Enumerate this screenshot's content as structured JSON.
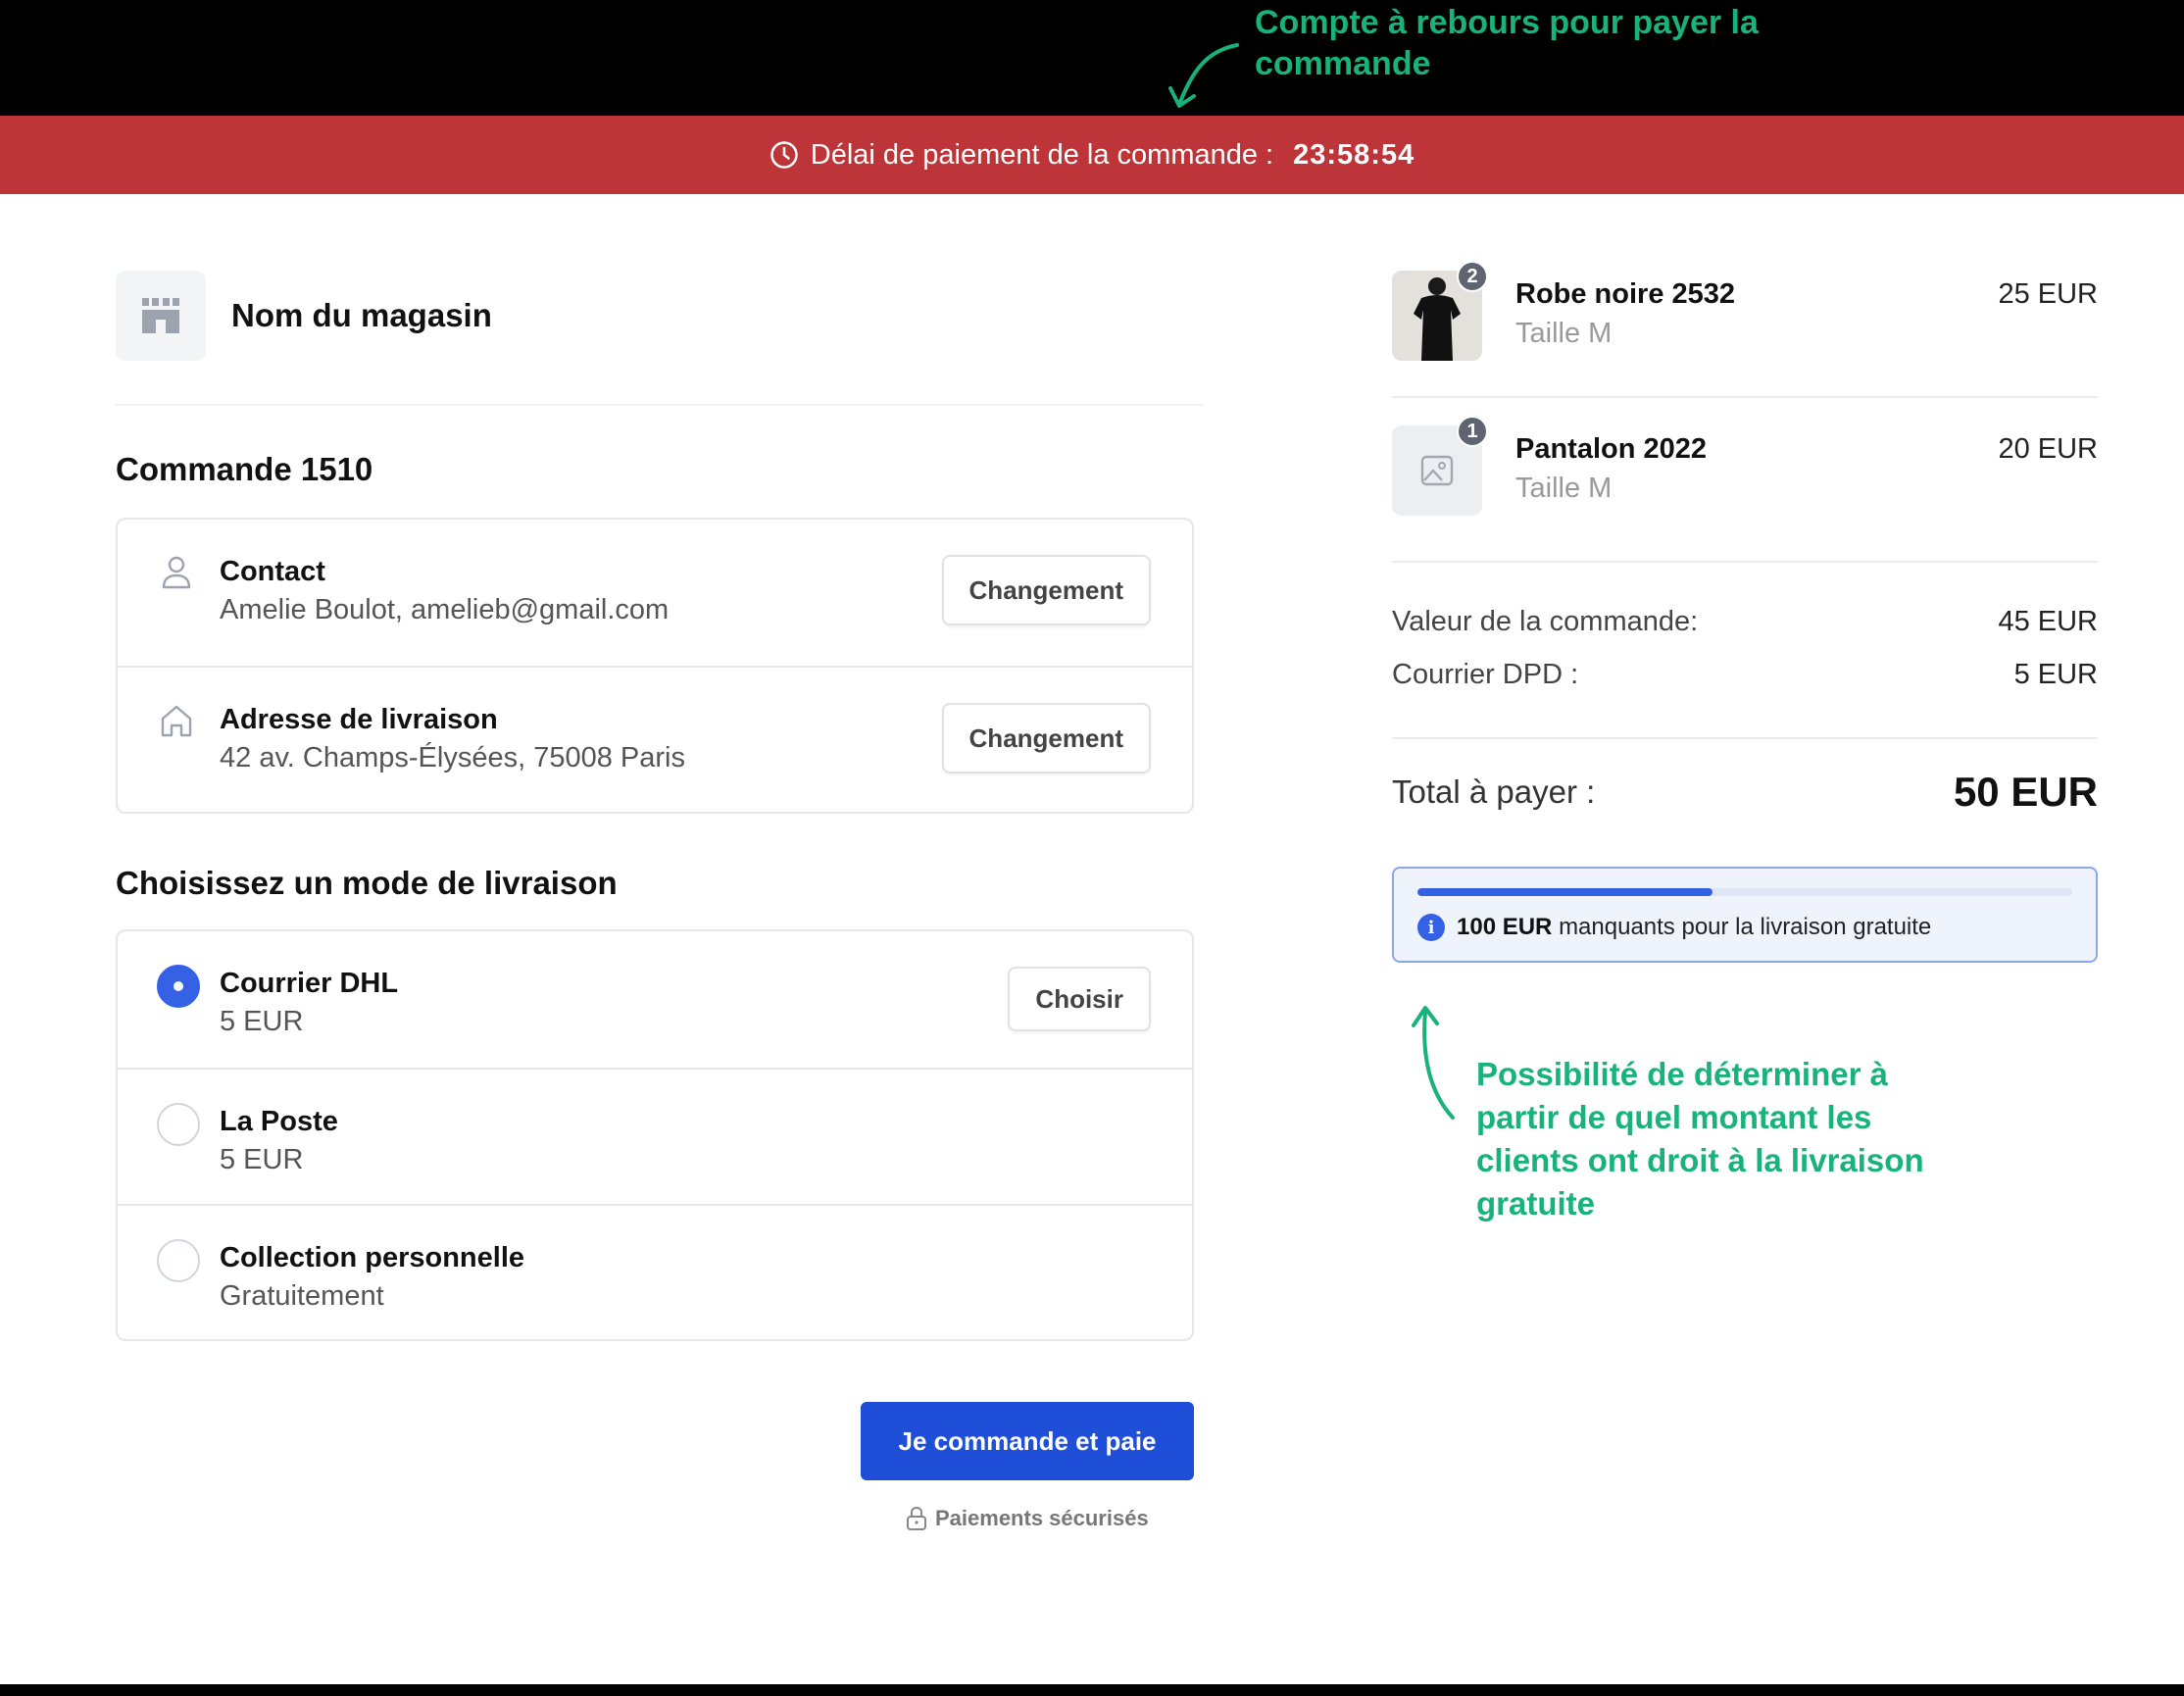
{
  "annotations": {
    "countdown": "Compte à rebours pour payer la commande",
    "free_shipping": "Possibilité de déterminer à partir de quel montant les clients ont droit à la livraison gratuite"
  },
  "timer": {
    "label": "Délai de paiement de la commande :",
    "value": "23:58:54",
    "color": "#bd3538"
  },
  "store": {
    "name": "Nom du magasin"
  },
  "order": {
    "title": "Commande 1510",
    "contact": {
      "title": "Contact",
      "value": "Amelie Boulot, amelieb@gmail.com",
      "button": "Changement"
    },
    "address": {
      "title": "Adresse de livraison",
      "value": "42 av. Champs-Élysées, 75008 Paris",
      "button": "Changement"
    }
  },
  "shipping": {
    "title": "Choisissez un mode de livraison",
    "options": [
      {
        "name": "Courrier DHL",
        "price": "5 EUR",
        "selected": true,
        "button": "Choisir"
      },
      {
        "name": "La Poste",
        "price": "5 EUR",
        "selected": false
      },
      {
        "name": "Collection personnelle",
        "price": "Gratuitement",
        "selected": false
      }
    ]
  },
  "checkout": {
    "button": "Je commande et paie",
    "secure": "Paiements sécurisés",
    "accent": "#1f4fd8"
  },
  "cart": {
    "items": [
      {
        "name": "Robe noire 2532",
        "size": "Taille M",
        "price": "25 EUR",
        "qty": "2"
      },
      {
        "name": "Pantalon 2022",
        "size": "Taille M",
        "price": "20 EUR",
        "qty": "1"
      }
    ],
    "summary": {
      "order_value_label": "Valeur de la commande:",
      "order_value": "45 EUR",
      "shipping_label": "Courrier DPD :",
      "shipping_value": "5 EUR",
      "total_label": "Total à payer :",
      "total_value": "50 EUR"
    },
    "free_shipping": {
      "amount": "100 EUR",
      "text": "manquants pour la livraison gratuite",
      "progress_percent": 45
    }
  }
}
